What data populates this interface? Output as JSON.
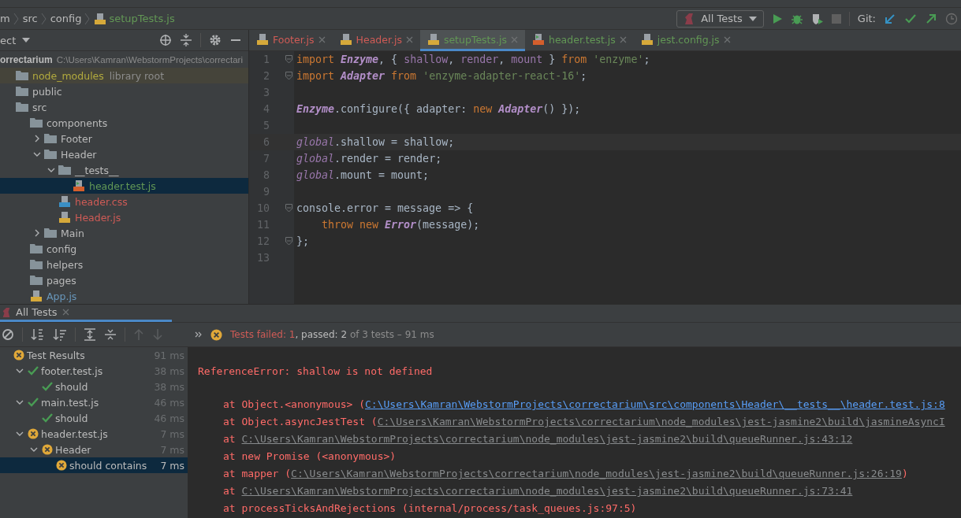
{
  "breadcrumbs": [
    {
      "label": "m",
      "kind": "folder"
    },
    {
      "label": "src",
      "kind": "folder"
    },
    {
      "label": "config",
      "kind": "folder"
    },
    {
      "label": "setupTests.js",
      "kind": "js",
      "color": "#629755"
    }
  ],
  "run_toolbar": {
    "configuration": "All Tests",
    "vcs_label": "Git:"
  },
  "project": {
    "title": "ect",
    "root": {
      "name": "orrectarium",
      "path": "C:\\Users\\Kamran\\WebstormProjects\\correctari"
    },
    "tree": [
      {
        "name": "node_modules",
        "kind": "library",
        "note": "library root",
        "selected": false
      },
      {
        "name": "public",
        "kind": "folder",
        "selected": false
      },
      {
        "name": "src",
        "kind": "folder",
        "selected": false,
        "children": [
          {
            "name": "components",
            "kind": "folder",
            "selected": false,
            "children": [
              {
                "name": "Footer",
                "kind": "folder",
                "expanded": false,
                "selected": false
              },
              {
                "name": "Header",
                "kind": "folder",
                "expanded": true,
                "selected": false,
                "children": [
                  {
                    "name": "__tests__",
                    "kind": "folder",
                    "expanded": true,
                    "selected": false,
                    "children": [
                      {
                        "name": "header.test.js",
                        "kind": "test",
                        "color": "#629755",
                        "selected": true
                      }
                    ]
                  },
                  {
                    "name": "header.css",
                    "kind": "css",
                    "color": "#cf5b56",
                    "selected": false
                  },
                  {
                    "name": "Header.js",
                    "kind": "js",
                    "color": "#cf5b56",
                    "selected": false
                  }
                ]
              },
              {
                "name": "Main",
                "kind": "folder",
                "expanded": false,
                "selected": false
              }
            ]
          },
          {
            "name": "config",
            "kind": "folder",
            "selected": false
          },
          {
            "name": "helpers",
            "kind": "folder",
            "selected": false
          },
          {
            "name": "pages",
            "kind": "folder",
            "selected": false
          },
          {
            "name": "App.js",
            "kind": "js",
            "color": "#6897bb",
            "selected": false
          }
        ]
      }
    ]
  },
  "editor": {
    "tabs": [
      {
        "label": "Footer.js",
        "kind": "js",
        "color": "#cf5b56",
        "selected": false
      },
      {
        "label": "Header.js",
        "kind": "js",
        "color": "#cf5b56",
        "selected": false
      },
      {
        "label": "setupTests.js",
        "kind": "js",
        "color": "#629755",
        "selected": true
      },
      {
        "label": "header.test.js",
        "kind": "test",
        "color": "#629755",
        "selected": false
      },
      {
        "label": "jest.config.js",
        "kind": "js",
        "color": "#629755",
        "selected": false
      }
    ],
    "lines": [
      {
        "number": "1",
        "fold": true,
        "current": false,
        "tokens": [
          {
            "text": "import ",
            "kind": "kw"
          },
          {
            "text": "Enzyme",
            "kind": "class"
          },
          {
            "text": ", { ",
            "kind": "plain"
          },
          {
            "text": "shallow",
            "kind": "var"
          },
          {
            "text": ", ",
            "kind": "plain"
          },
          {
            "text": "render",
            "kind": "var"
          },
          {
            "text": ", ",
            "kind": "plain"
          },
          {
            "text": "mount",
            "kind": "var"
          },
          {
            "text": " } ",
            "kind": "plain"
          },
          {
            "text": "from ",
            "kind": "kw"
          },
          {
            "text": "'enzyme'",
            "kind": "str"
          },
          {
            "text": ";",
            "kind": "plain"
          }
        ]
      },
      {
        "number": "2",
        "fold": true,
        "current": false,
        "tokens": [
          {
            "text": "import ",
            "kind": "kw"
          },
          {
            "text": "Adapter",
            "kind": "class"
          },
          {
            "text": " from ",
            "kind": "kw"
          },
          {
            "text": "'enzyme-adapter-react-16'",
            "kind": "str"
          },
          {
            "text": ";",
            "kind": "plain"
          }
        ]
      },
      {
        "number": "3",
        "fold": false,
        "current": false
      },
      {
        "number": "4",
        "fold": false,
        "current": false,
        "tokens": [
          {
            "text": "Enzyme",
            "kind": "class"
          },
          {
            "text": ".configure({ adapter: ",
            "kind": "plain"
          },
          {
            "text": "new ",
            "kind": "kw"
          },
          {
            "text": "Adapter",
            "kind": "class"
          },
          {
            "text": "() });",
            "kind": "plain"
          }
        ]
      },
      {
        "number": "5",
        "fold": false,
        "current": false
      },
      {
        "number": "6",
        "fold": false,
        "current": true,
        "tokens": [
          {
            "text": "global",
            "kind": "global"
          },
          {
            "text": ".shallow = shallow;",
            "kind": "plain"
          }
        ]
      },
      {
        "number": "7",
        "fold": false,
        "current": false,
        "tokens": [
          {
            "text": "global",
            "kind": "global"
          },
          {
            "text": ".render = render;",
            "kind": "plain"
          }
        ]
      },
      {
        "number": "8",
        "fold": false,
        "current": false,
        "tokens": [
          {
            "text": "global",
            "kind": "global"
          },
          {
            "text": ".mount = mount;",
            "kind": "plain"
          }
        ]
      },
      {
        "number": "9",
        "fold": false,
        "current": false
      },
      {
        "number": "10",
        "fold": true,
        "current": false,
        "tokens": [
          {
            "text": "console.error = message => {",
            "kind": "plain"
          }
        ]
      },
      {
        "number": "11",
        "fold": false,
        "current": false,
        "tokens": [
          {
            "text": "    throw new ",
            "kind": "kw"
          },
          {
            "text": "Error",
            "kind": "class"
          },
          {
            "text": "(message);",
            "kind": "plain"
          }
        ]
      },
      {
        "number": "12",
        "fold": true,
        "current": false,
        "tokens": [
          {
            "text": "};",
            "kind": "plain"
          }
        ]
      },
      {
        "number": "13",
        "fold": false,
        "current": false
      }
    ]
  },
  "run_panel": {
    "tab": "All Tests",
    "summary": {
      "failed": "Tests failed: 1",
      "passed": ", passed: 2",
      "total": "of 3 tests – 91 ms"
    },
    "tests": [
      {
        "name": "Test Results",
        "failed": true,
        "time": "91 ms",
        "selected": false,
        "children": [
          {
            "name": "footer.test.js",
            "failed": false,
            "time": "38 ms",
            "expanded": true,
            "selected": false,
            "children": [
              {
                "name": "should",
                "failed": false,
                "time": "38 ms",
                "selected": false
              }
            ]
          },
          {
            "name": "main.test.js",
            "failed": false,
            "time": "46 ms",
            "expanded": true,
            "selected": false,
            "children": [
              {
                "name": "should",
                "failed": false,
                "time": "46 ms",
                "selected": false
              }
            ]
          },
          {
            "name": "header.test.js",
            "failed": true,
            "time": "7 ms",
            "expanded": true,
            "selected": false,
            "children": [
              {
                "name": "Header",
                "failed": true,
                "time": "7 ms",
                "expanded": true,
                "selected": false,
                "children": [
                  {
                    "name": "should contains",
                    "failed": true,
                    "time": "7 ms",
                    "selected": true
                  }
                ]
              }
            ]
          }
        ]
      }
    ],
    "console": {
      "error": "ReferenceError: shallow is not defined",
      "stack": [
        {
          "prefix": "at Object.<anonymous> (",
          "link": "C:\\Users\\Kamran\\WebstormProjects\\correctarium\\src\\components\\Header\\__tests__\\header.test.js:8",
          "color": "#589df6"
        },
        {
          "prefix": "at Object.asyncJestTest (",
          "link": "C:\\Users\\Kamran\\WebstormProjects\\correctarium\\node_modules\\jest-jasmine2\\build\\jasmineAsyncI",
          "color": "#888b8d"
        },
        {
          "prefix": "at ",
          "link": "C:\\Users\\Kamran\\WebstormProjects\\correctarium\\node_modules\\jest-jasmine2\\build\\queueRunner.js:43:12",
          "color": "#888b8d"
        },
        {
          "prefix": "at new Promise (<anonymous>)"
        },
        {
          "prefix": "at mapper (",
          "link": "C:\\Users\\Kamran\\WebstormProjects\\correctarium\\node_modules\\jest-jasmine2\\build\\queueRunner.js:26:19",
          "color": "#888b8d",
          "suffix": ")"
        },
        {
          "prefix": "at ",
          "link": "C:\\Users\\Kamran\\WebstormProjects\\correctarium\\node_modules\\jest-jasmine2\\build\\queueRunner.js:73:41",
          "color": "#888b8d"
        },
        {
          "prefix": "at processTicksAndRejections (internal/process/task_queues.js:97:5)"
        }
      ]
    }
  }
}
